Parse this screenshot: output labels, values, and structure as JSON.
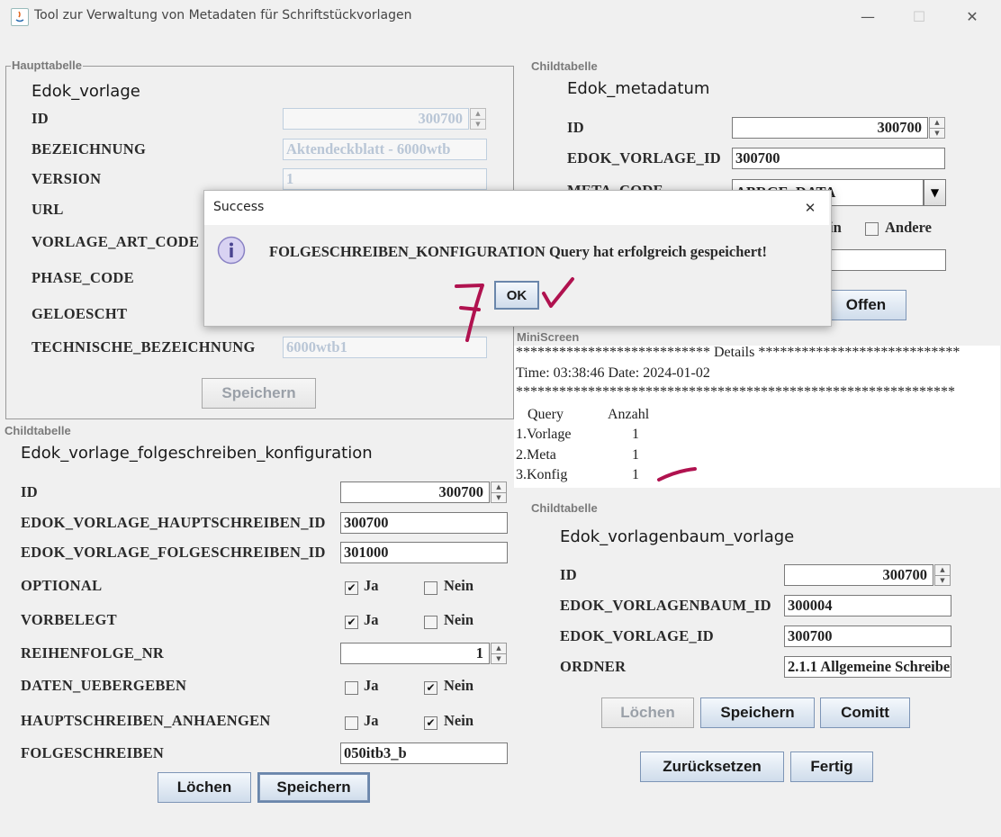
{
  "window": {
    "title": "Tool zur Verwaltung von Metadaten für Schriftstückvorlagen",
    "minimize_glyph": "—",
    "maximize_glyph": "☐",
    "close_glyph": "✕"
  },
  "haupttabelle": {
    "caption": "Haupttabelle",
    "title": "Edok_vorlage",
    "labels": [
      "ID",
      "BEZEICHNUNG",
      "VERSION",
      "URL",
      "VORLAGE_ART_CODE",
      "PHASE_CODE",
      "GELOESCHT",
      "TECHNISCHE_BEZEICHNUNG"
    ],
    "id_value": "300700",
    "bezeichnung_value": "Aktendeckblatt - 6000wtb",
    "version_value": "1",
    "technische_bezeichnung_value": "6000wtb1",
    "save_label": "Speichern"
  },
  "metadatum": {
    "caption": "Childtabelle",
    "title": "Edok_metadatum",
    "labels": [
      "ID",
      "EDOK_VORLAGE_ID",
      "META_CODE"
    ],
    "id_value": "300700",
    "edok_vorlage_id_value": "300700",
    "meta_code_value": "ABRGE_DATA",
    "partial_option": "in",
    "andere_label": "Andere",
    "offen_label": "Offen"
  },
  "miniscreen": {
    "caption": "MiniScreen",
    "line1": "*************************** Details ****************************",
    "line2": "Time: 03:38:46 Date: 2024-01-02",
    "line3": "*************************************************************",
    "header_query": "Query",
    "header_anzahl": "Anzahl",
    "rows": [
      {
        "query": "1.Vorlage",
        "anzahl": "1"
      },
      {
        "query": "2.Meta",
        "anzahl": "1"
      },
      {
        "query": "3.Konfig",
        "anzahl": "1"
      }
    ]
  },
  "konfiguration": {
    "caption": "Childtabelle",
    "title": "Edok_vorlage_folgeschreiben_konfiguration",
    "labels": [
      "ID",
      "EDOK_VORLAGE_HAUPTSCHREIBEN_ID",
      "EDOK_VORLAGE_FOLGESCHREIBEN_ID",
      "OPTIONAL",
      "VORBELEGT",
      "REIHENFOLGE_NR",
      "DATEN_UEBERGEBEN",
      "HAUPTSCHREIBEN_ANHAENGEN",
      "FOLGESCHREIBEN"
    ],
    "id_value": "300700",
    "hauptschreiben_id_value": "300700",
    "folgeschreiben_id_value": "301000",
    "reihenfolge_value": "1",
    "folgeschreiben_value": "050itb3_b",
    "ja_label": "Ja",
    "nein_label": "Nein",
    "optional": {
      "ja": true,
      "nein": false
    },
    "vorbelegt": {
      "ja": true,
      "nein": false
    },
    "daten_uebergeben": {
      "ja": false,
      "nein": true
    },
    "hauptschreiben_anhaengen": {
      "ja": false,
      "nein": true
    },
    "loeschen_label": "Löchen",
    "speichern_label": "Speichern"
  },
  "vorlagenbaum": {
    "caption": "Childtabelle",
    "title": "Edok_vorlagenbaum_vorlage",
    "labels": [
      "ID",
      "EDOK_VORLAGENBAUM_ID",
      "EDOK_VORLAGE_ID",
      "ORDNER"
    ],
    "id_value": "300700",
    "vorlagenbaum_id_value": "300004",
    "vorlage_id_value": "300700",
    "ordner_value": "2.1.1 Allgemeine Schreiben",
    "loeschen_label": "Löchen",
    "speichern_label": "Speichern",
    "comitt_label": "Comitt",
    "zuruecksetzen_label": "Zurücksetzen",
    "fertig_label": "Fertig"
  },
  "dialog": {
    "title": "Success",
    "message": "FOLGESCHREIBEN_KONFIGURATION Query hat erfolgreich gespeichert!",
    "ok_label": "OK",
    "close_glyph": "✕"
  },
  "annotations": {
    "ink_color": "#b0124f",
    "number": "7"
  }
}
